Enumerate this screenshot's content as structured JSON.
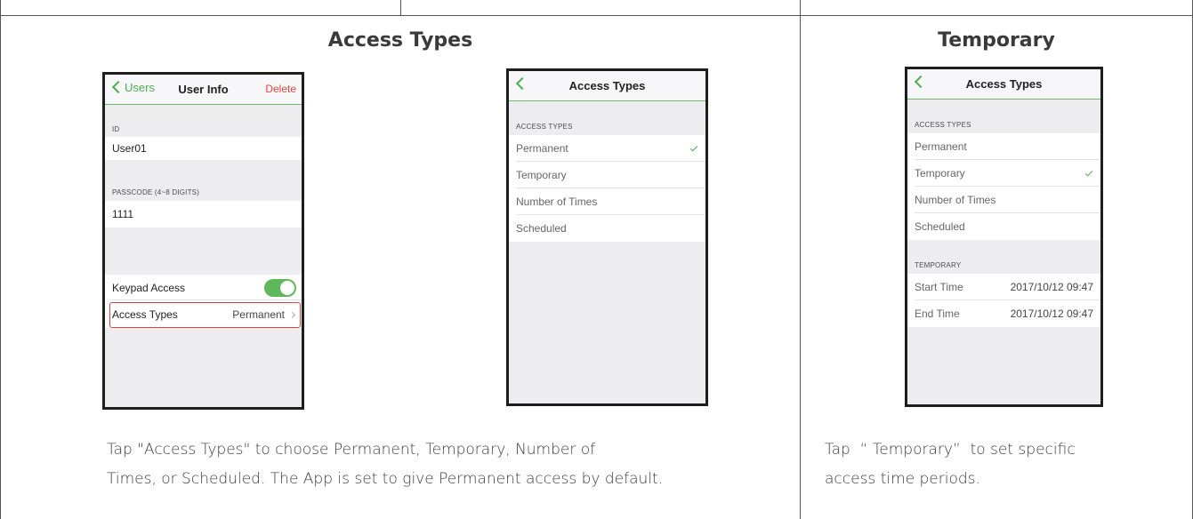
{
  "sections": {
    "access_types_title": "Access Types",
    "temporary_title": "Temporary"
  },
  "screen1": {
    "back": "Users",
    "title": "User Info",
    "right": "Delete",
    "id_label": "ID",
    "id_value": "User01",
    "passcode_label": "PASSCODE (4~8 DIGITS)",
    "passcode_value": "1111",
    "keypad_label": "Keypad Access",
    "keypad_enabled": true,
    "access_label": "Access Types",
    "access_value": "Permanent"
  },
  "screen2": {
    "title": "Access Types",
    "section_label": "ACCESS TYPES",
    "options": [
      "Permanent",
      "Temporary",
      "Number of Times",
      "Scheduled"
    ],
    "selected": "Permanent"
  },
  "screen3": {
    "title": "Access Types",
    "section_label": "ACCESS TYPES",
    "options": [
      "Permanent",
      "Temporary",
      "Number of Times",
      "Scheduled"
    ],
    "selected": "Temporary",
    "temp_label": "TEMPORARY",
    "start_label": "Start Time",
    "start_value": "2017/10/12 09:47",
    "end_label": "End Time",
    "end_value": "2017/10/12 09:47"
  },
  "descriptions": {
    "left_line1": "Tap \"Access Types\" to choose Permanent, Temporary, Number of",
    "left_line2": "Times, or Scheduled. The App is set to give Permanent access by default.",
    "right_line1": "Tap  “ Temporary”  to set specific",
    "right_line2": "access time periods."
  },
  "colors": {
    "accent": "#4caf50",
    "delete": "#e8463c",
    "highlight": "#d94545"
  }
}
